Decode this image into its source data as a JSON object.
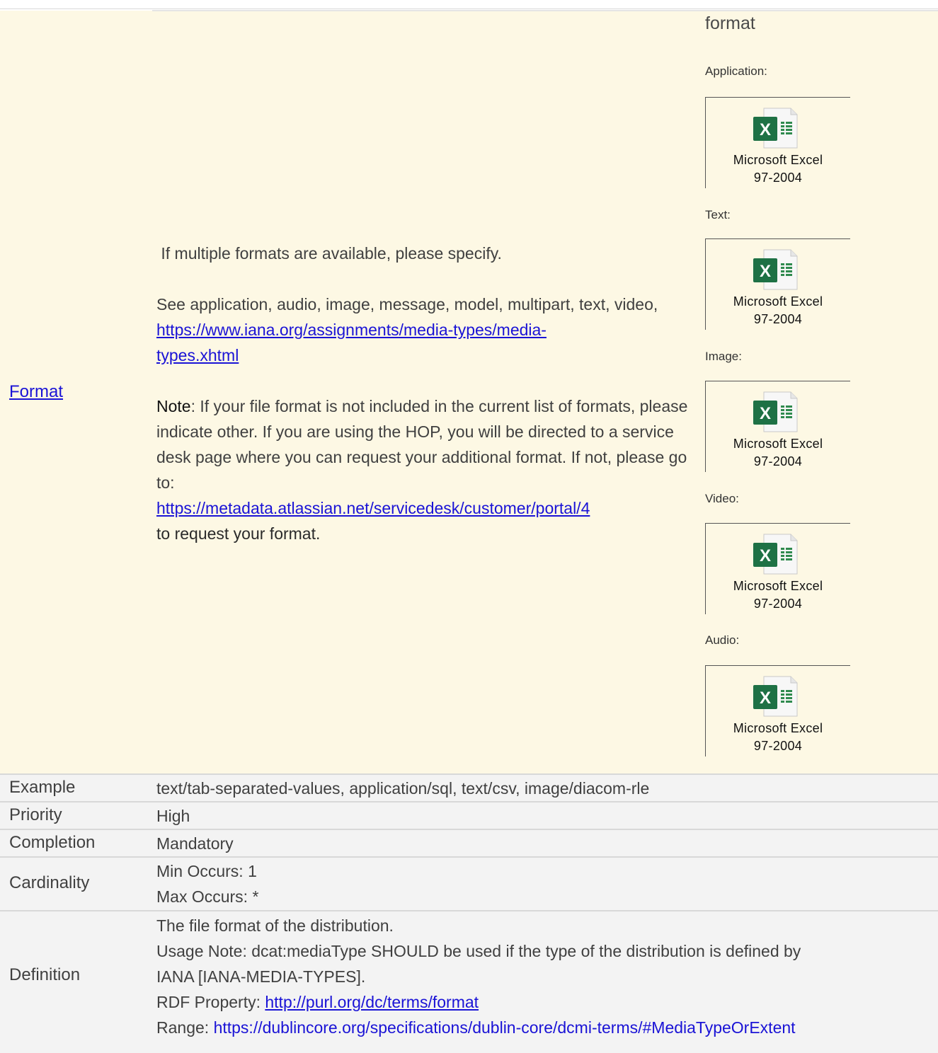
{
  "element_name": "Format",
  "description": {
    "intro": " If multiple formats are available, please specify.",
    "see_prefix": "See application, audio, image, message, model, multipart, text, video,  ",
    "see_link": "https://www.iana.org/assignments/media-types/media-types.xhtml",
    "see_link_line1": "https://www.iana.org/assignments/media-types/media-",
    "see_link_line2": "types.xhtml",
    "note_label": "Note",
    "note_text": ": If your file format is not included in the current list of formats, please indicate other. If you are using the HOP, you will be directed to a service desk page where you can request your additional format. If not, please go to:",
    "note_link": "https://metadata.atlassian.net/servicedesk/customer/portal/4",
    "note_suffix": "to request your format."
  },
  "format_list": {
    "heading": "format",
    "attachments": [
      {
        "category": "Application:",
        "file_label_1": "Microsoft Excel",
        "file_label_2": "97-2004",
        "icon": "excel-icon"
      },
      {
        "category": "Text:",
        "file_label_1": "Microsoft Excel",
        "file_label_2": "97-2004",
        "icon": "excel-icon"
      },
      {
        "category": "Image:",
        "file_label_1": "Microsoft Excel",
        "file_label_2": "97-2004",
        "icon": "excel-icon"
      },
      {
        "category": "Video:",
        "file_label_1": "Microsoft Excel",
        "file_label_2": "97-2004",
        "icon": "excel-icon"
      },
      {
        "category": "Audio:",
        "file_label_1": "Microsoft Excel",
        "file_label_2": "97-2004",
        "icon": "excel-icon"
      }
    ]
  },
  "properties": {
    "example": {
      "label": "Example",
      "value": "text/tab-separated-values, application/sql, text/csv, image/diacom-rle"
    },
    "priority": {
      "label": "Priority",
      "value": "High"
    },
    "completion": {
      "label": "Completion",
      "value": "Mandatory"
    },
    "cardinality": {
      "label": "Cardinality",
      "min": "Min Occurs: 1",
      "max": "Max Occurs: *"
    },
    "definition": {
      "label": "Definition",
      "line1": "The file format of the distribution.",
      "line2": "Usage Note: dcat:mediaType SHOULD be used if the type of the distribution is defined by",
      "line3": "IANA [IANA-MEDIA-TYPES].",
      "rdf_prefix": "RDF Property: ",
      "rdf_link": "http://purl.org/dc/terms/format",
      "range_prefix": "Range: ",
      "range_link": "https://dublincore.org/specifications/dublin-core/dcmi-terms/#MediaTypeOrExtent"
    }
  },
  "colors": {
    "link": "#1a13d6",
    "highlight_bg": "#fdf8e4",
    "table_bg": "#f3f3f3",
    "excel_green": "#1e7145"
  }
}
